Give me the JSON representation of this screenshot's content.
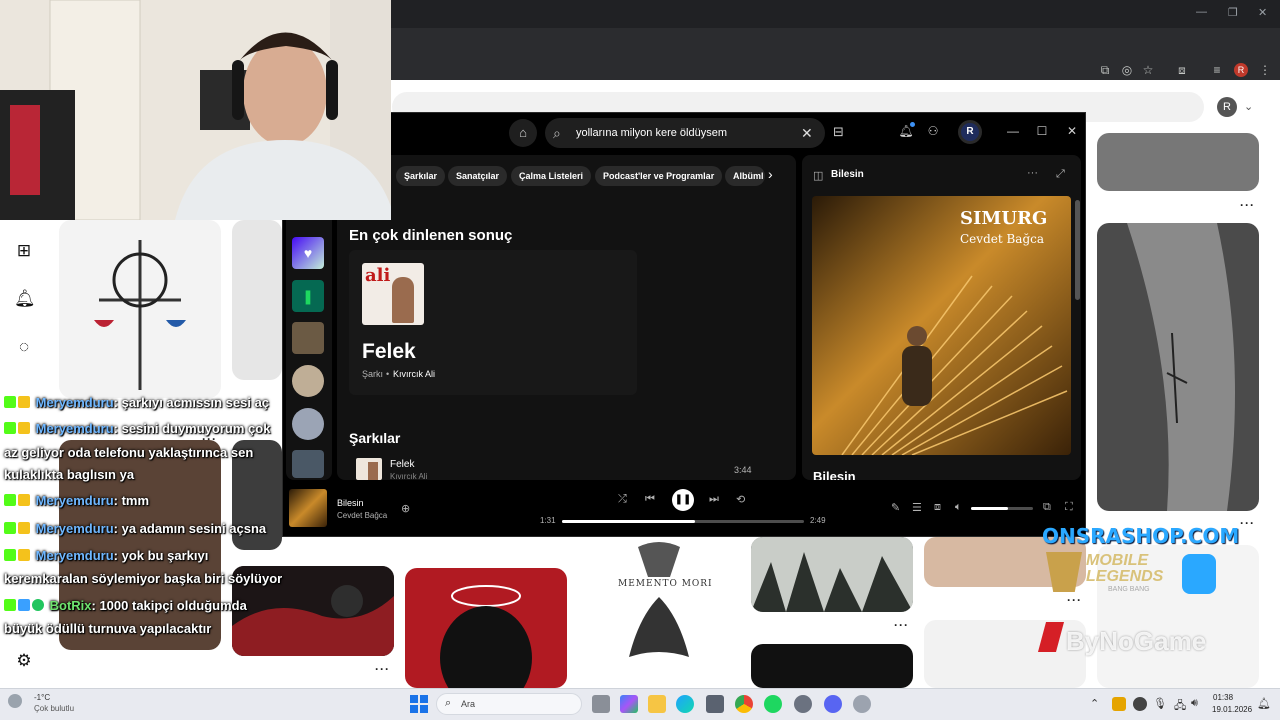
{
  "browser": {
    "profile_initial": "R"
  },
  "pinterest": {
    "avatar_initial": "R",
    "pin_more": "···",
    "pins_text": {
      "memento": "MEMENTO MORI"
    }
  },
  "spotify": {
    "search_value": "yollarına milyon kere öldüysem",
    "user_initial": "R",
    "filters": [
      "Şarkılar",
      "Sanatçılar",
      "Çalma Listeleri",
      "Podcast'ler ve Programlar",
      "Albüml"
    ],
    "top_result_heading": "En çok dinlenen sonuç",
    "top_result": {
      "title": "Felek",
      "type": "Şarkı",
      "artist": "Kıvırcık Ali",
      "cover_text": "ali"
    },
    "songs_heading": "Şarkılar",
    "songs": [
      {
        "title": "Felek",
        "artist": "Kıvırcık Ali",
        "duration": "3:44"
      }
    ],
    "now_playing_panel": {
      "title": "Bilesin",
      "album_title": "SIMURG",
      "album_artist": "Cevdet Bağca",
      "below_title": "Bilesin"
    },
    "player": {
      "track": "Bilesin",
      "artist": "Cevdet Bağca",
      "elapsed": "1:31",
      "total": "2:49",
      "progress": 0.55,
      "volume": 0.6
    }
  },
  "chat": [
    {
      "user": "Meryemduru",
      "text": ": şarkıyı acmıssın sesi aç"
    },
    {
      "user": "Meryemduru",
      "text": ": sesini duymuyorum çok"
    },
    {
      "user": "",
      "text": "az geliyor oda telefonu yaklaştırınca sen"
    },
    {
      "user": "",
      "text": "kulaklıkta baglısın ya"
    },
    {
      "user": "Meryemduru",
      "text": ": tmm"
    },
    {
      "user": "Meryemduru",
      "text": ": ya adamın sesini açsna"
    },
    {
      "user": "Meryemduru",
      "text": ": yok bu şarkıyı"
    },
    {
      "user": "",
      "text": "keremkaralan söylemiyor başka biri söylüyor"
    },
    {
      "user": "BotRix",
      "text": ": 1000 takipçi olduğumda"
    },
    {
      "user": "",
      "text": "büyük ödüllü turnuva yapılacaktır"
    }
  ],
  "overlay": {
    "shop": "ONSRASHOP.COM",
    "game_line1": "MOBILE",
    "game_line2": "LEGENDS",
    "game_line3": "BANG BANG",
    "sponsor": "ByNoGame"
  },
  "taskbar": {
    "weather_temp": "-1°C",
    "weather_text": "Çok bulutlu",
    "search_placeholder": "Ara",
    "time": "01:38",
    "date": "19.01.2026"
  },
  "colors": {
    "spotify_green": "#1ed760",
    "chat_user": "#6fb7ff",
    "bot_user": "#6ee36e",
    "shop_blue": "#2aa8ff"
  }
}
